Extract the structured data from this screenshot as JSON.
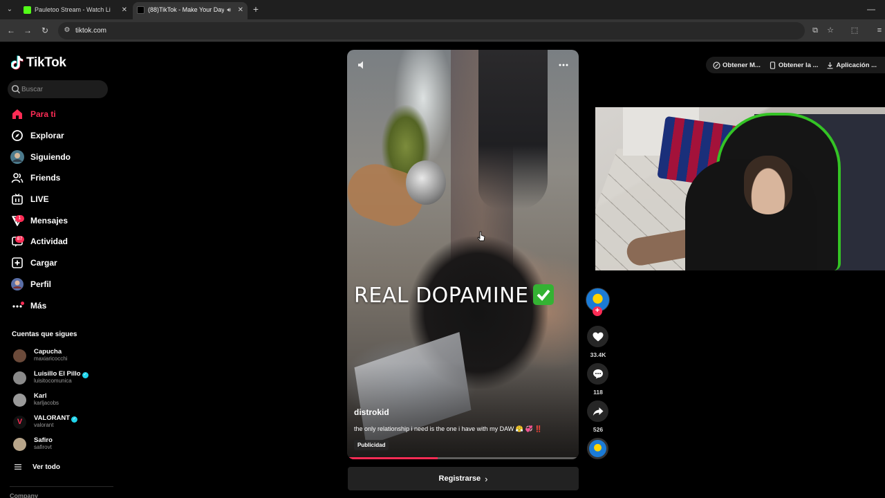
{
  "browser": {
    "tabs": [
      {
        "title": "Pauletoo Stream - Watch Live o",
        "active": false
      },
      {
        "title": "(88)TikTok - Make Your Day",
        "active": true
      }
    ],
    "url": "tiktok.com"
  },
  "sidebar": {
    "logo": "TikTok",
    "search_placeholder": "Buscar",
    "nav": [
      {
        "label": "Para ti",
        "icon": "home-icon",
        "active": true
      },
      {
        "label": "Explorar",
        "icon": "compass-icon"
      },
      {
        "label": "Siguiendo",
        "icon": "following-avatar-icon"
      },
      {
        "label": "Friends",
        "icon": "friends-icon"
      },
      {
        "label": "LIVE",
        "icon": "live-icon"
      },
      {
        "label": "Mensajes",
        "icon": "messages-icon",
        "badge": "1"
      },
      {
        "label": "Actividad",
        "icon": "activity-icon",
        "badge": "87"
      },
      {
        "label": "Cargar",
        "icon": "upload-icon"
      },
      {
        "label": "Perfil",
        "icon": "profile-avatar-icon"
      },
      {
        "label": "Más",
        "icon": "more-icon"
      }
    ],
    "following_title": "Cuentas que sigues",
    "accounts": [
      {
        "name": "Capucha",
        "username": "maxiaricocchi",
        "verified": false,
        "color": "#6b4a3a"
      },
      {
        "name": "Luisillo El Pillo",
        "username": "luisitocomunica",
        "verified": true,
        "color": "#8a8a8a"
      },
      {
        "name": "Karl",
        "username": "karljacobs",
        "verified": false,
        "color": "#9a9a9a"
      },
      {
        "name": "VALORANT",
        "username": "valorant",
        "verified": true,
        "color": "#1a1a1a"
      },
      {
        "name": "Safiro",
        "username": "safirovt",
        "verified": false,
        "color": "#b8a58a"
      }
    ],
    "see_all": "Ver todo",
    "company": "Company"
  },
  "video": {
    "caption": "REAL DOPAMINE",
    "author": "distrokid",
    "description": "the only relationship i need is the one i have with my DAW 😤 💞 ‼️",
    "ad_label": "Publicidad",
    "progress": 0.39
  },
  "actions": {
    "likes": "33.4K",
    "comments": "118",
    "shares": "526"
  },
  "register_label": "Registrarse",
  "top_pills": [
    "Obtener M...",
    "Obtener la ...",
    "Aplicación ..."
  ],
  "colors": {
    "accent": "#fe2c55",
    "background": "#000000",
    "verified": "#20d5ec"
  }
}
